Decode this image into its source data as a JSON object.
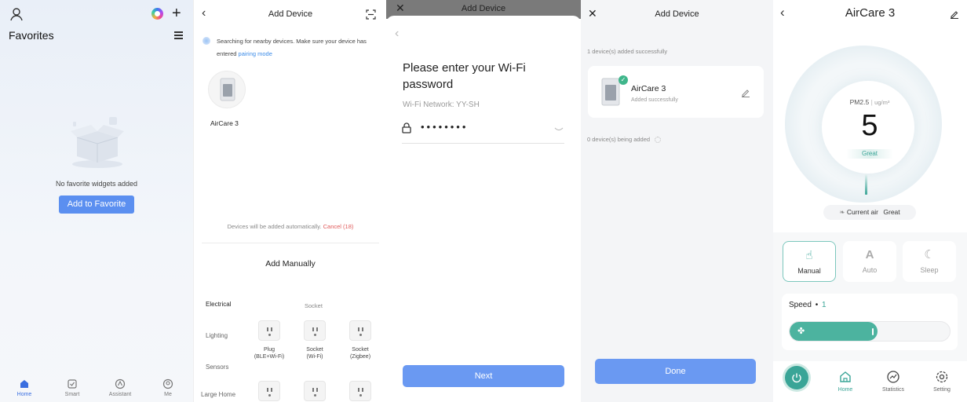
{
  "home": {
    "title": "Favorites",
    "empty_text": "No favorite widgets added",
    "add_button": "Add to Favorite",
    "nav": [
      {
        "label": "Home",
        "icon": "home-icon"
      },
      {
        "label": "Smart",
        "icon": "smart-icon"
      },
      {
        "label": "Assistant",
        "icon": "assistant-icon"
      },
      {
        "label": "Me",
        "icon": "me-icon"
      }
    ]
  },
  "search": {
    "title": "Add Device",
    "status_text": "Searching for nearby devices. Make sure your device has entered",
    "pairing_link": "pairing mode",
    "found_device": "AirCare 3",
    "auto_text": "Devices will be added automatically.",
    "cancel_text": "Cancel (18)",
    "manual_title": "Add Manually",
    "categories": [
      "Electrical",
      "Lighting",
      "Sensors",
      "Large Home"
    ],
    "socket_header": "Socket",
    "devices": [
      {
        "line1": "Plug",
        "line2": "(BLE+Wi-Fi)"
      },
      {
        "line1": "Socket",
        "line2": "(Wi-Fi)"
      },
      {
        "line1": "Socket",
        "line2": "(Zigbee)"
      }
    ]
  },
  "wifi": {
    "header_title": "Add Device",
    "prompt": "Please enter your Wi-Fi password",
    "network": "Wi-Fi Network: YY-SH",
    "password_mask": "••••••••",
    "next_button": "Next"
  },
  "added": {
    "title": "Add Device",
    "success_text": "1 device(s) added successfully",
    "device_name": "AirCare 3",
    "device_status": "Added successfully",
    "pending_text": "0 device(s) being added",
    "done_button": "Done"
  },
  "device": {
    "title": "AirCare 3",
    "pm_label": "PM2.5",
    "pm_unit": "ug/m³",
    "pm_value": "5",
    "quality": "Great",
    "current_air_label": "Current air",
    "current_air_value": "Great",
    "modes": [
      {
        "label": "Manual",
        "active": true
      },
      {
        "label": "Auto",
        "active": false
      },
      {
        "label": "Sleep",
        "active": false
      }
    ],
    "speed_label": "Speed",
    "speed_value": "1",
    "speed_fraction": 0.55,
    "nav": [
      {
        "label": "Home"
      },
      {
        "label": "Statistics"
      },
      {
        "label": "Setting"
      }
    ],
    "accent_color": "#3aa597"
  }
}
